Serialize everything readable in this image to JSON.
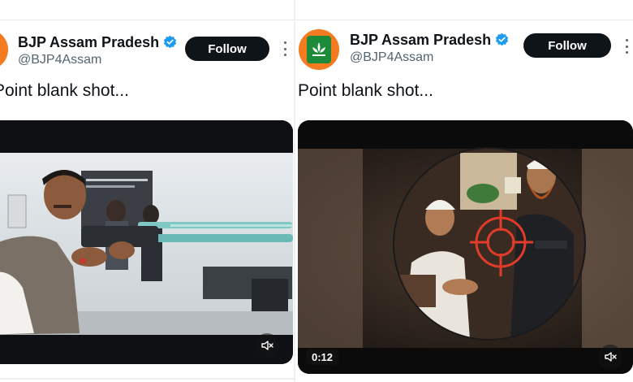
{
  "left_post": {
    "name": "BJP Assam Pradesh",
    "handle": "@BJP4Assam",
    "follow_label": "Follow",
    "text": "Point blank shot...",
    "video": {
      "muted": true
    }
  },
  "right_post": {
    "name": "BJP Assam Pradesh",
    "handle": "@BJP4Assam",
    "follow_label": "Follow",
    "text": "Point blank shot...",
    "video": {
      "timestamp": "0:12",
      "muted": true
    }
  },
  "colors": {
    "follow_bg": "#0f1419",
    "verified": "#1d9bf0",
    "handle": "#536471",
    "avatar_bg": "#f47b20",
    "reticle": "#e23b2a"
  }
}
